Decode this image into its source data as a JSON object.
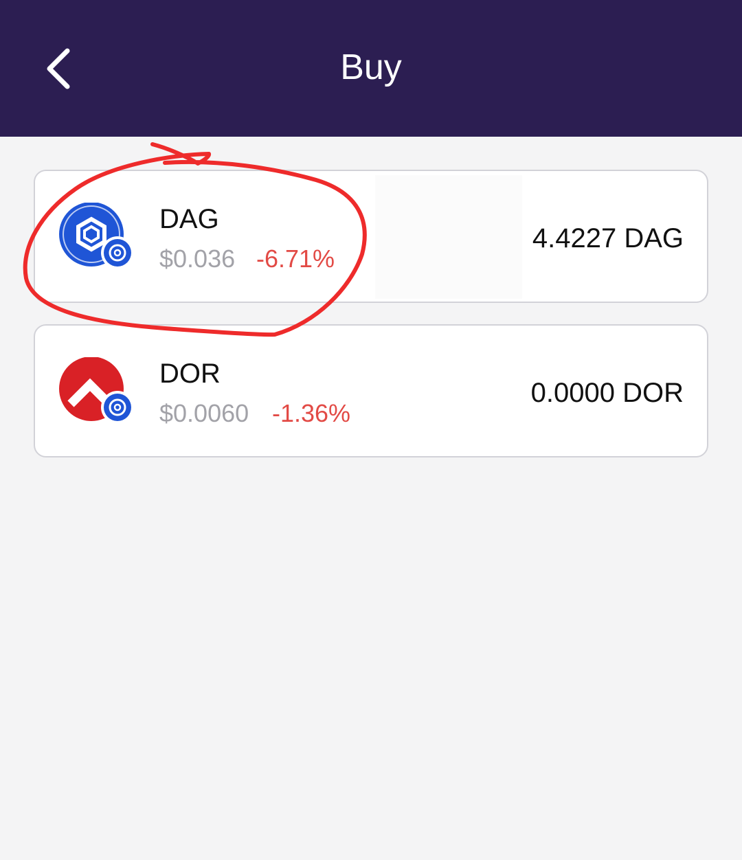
{
  "header": {
    "title": "Buy",
    "back_icon": "chevron-left-icon"
  },
  "tokens": [
    {
      "symbol": "DAG",
      "price": "$0.036",
      "change": "-6.71%",
      "balance": "4.4227 DAG",
      "icon": "dag-token-icon",
      "color": "#1f55d6"
    },
    {
      "symbol": "DOR",
      "price": "$0.0060",
      "change": "-1.36%",
      "balance": "0.0000 DOR",
      "icon": "dor-token-icon",
      "color": "#d92126"
    }
  ],
  "colors": {
    "header_bg": "#2c1e52",
    "page_bg": "#f4f4f5",
    "negative_change": "#e24a45",
    "annotation": "#ee2b2b"
  }
}
